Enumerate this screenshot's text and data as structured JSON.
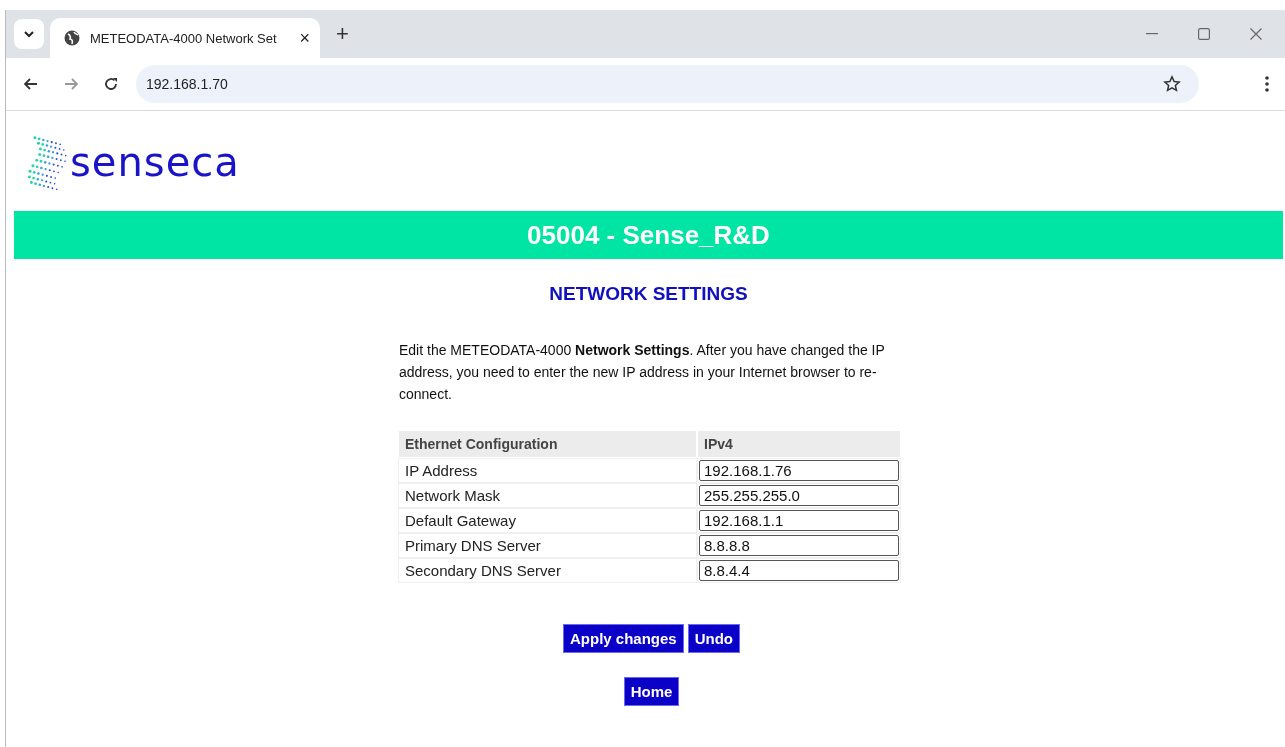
{
  "browser": {
    "tab": {
      "title": "METEODATA-4000 Network Set",
      "selected": true
    },
    "close_tab": "×",
    "new_tab": "+",
    "url": "192.168.1.70"
  },
  "logo": {
    "text": "senseca"
  },
  "banner": {
    "title": "05004 - Sense_R&D"
  },
  "heading": "NETWORK SETTINGS",
  "intro": "Edit the METEODATA-4000 **Network Settings**. After you have changed the IP address, you need to enter the new IP address in your Internet browser to re-connect.",
  "table": {
    "columns": [
      "Ethernet Configuration",
      "IPv4"
    ],
    "rows": [
      {
        "label": "IP Address",
        "value": "192.168.1.76"
      },
      {
        "label": "Network Mask",
        "value": "255.255.255.0"
      },
      {
        "label": "Default Gateway",
        "value": "192.168.1.1"
      },
      {
        "label": "Primary DNS Server",
        "value": "8.8.8.8"
      },
      {
        "label": "Secondary DNS Server",
        "value": "8.8.4.4"
      }
    ]
  },
  "actions": [
    "Apply changes",
    "Undo"
  ],
  "home": "Home"
}
